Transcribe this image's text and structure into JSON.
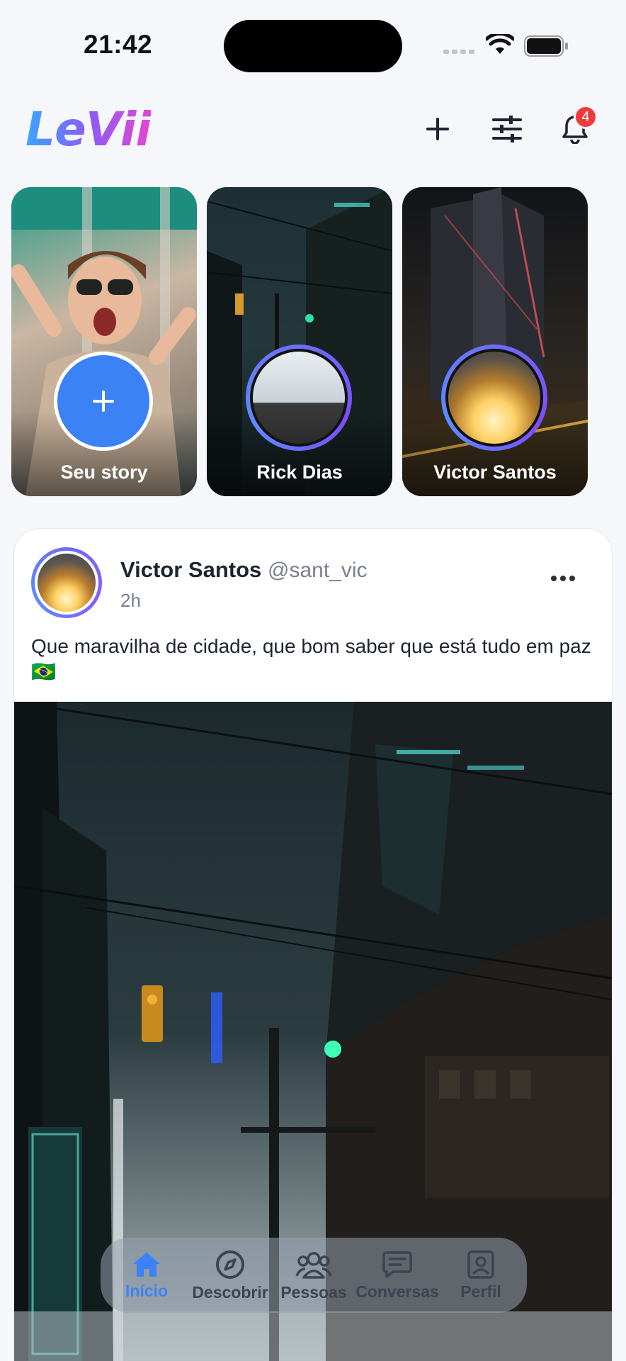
{
  "status_bar": {
    "time": "21:42"
  },
  "header": {
    "logo": "LeVii",
    "notifications_count": "4"
  },
  "stories": [
    {
      "label": "Seu story",
      "type": "add"
    },
    {
      "label": "Rick Dias",
      "type": "user"
    },
    {
      "label": "Victor Santos",
      "type": "user"
    }
  ],
  "post": {
    "author_name": "Victor Santos",
    "author_handle": "@sant_vic",
    "time": "2h",
    "text": "Que maravilha de cidade, que bom saber que está tudo em paz 🇧🇷"
  },
  "bottom_nav": [
    {
      "label": "Início",
      "icon": "home-icon",
      "active": true
    },
    {
      "label": "Descobrir",
      "icon": "compass-icon",
      "active": false
    },
    {
      "label": "Pessoas",
      "icon": "people-icon",
      "active": false
    },
    {
      "label": "Conversas",
      "icon": "chat-icon",
      "active": false
    },
    {
      "label": "Perfil",
      "icon": "profile-icon",
      "active": false
    }
  ],
  "colors": {
    "accent": "#3b82f6",
    "badge": "#ef3b3b",
    "background": "#f6f7fb"
  }
}
